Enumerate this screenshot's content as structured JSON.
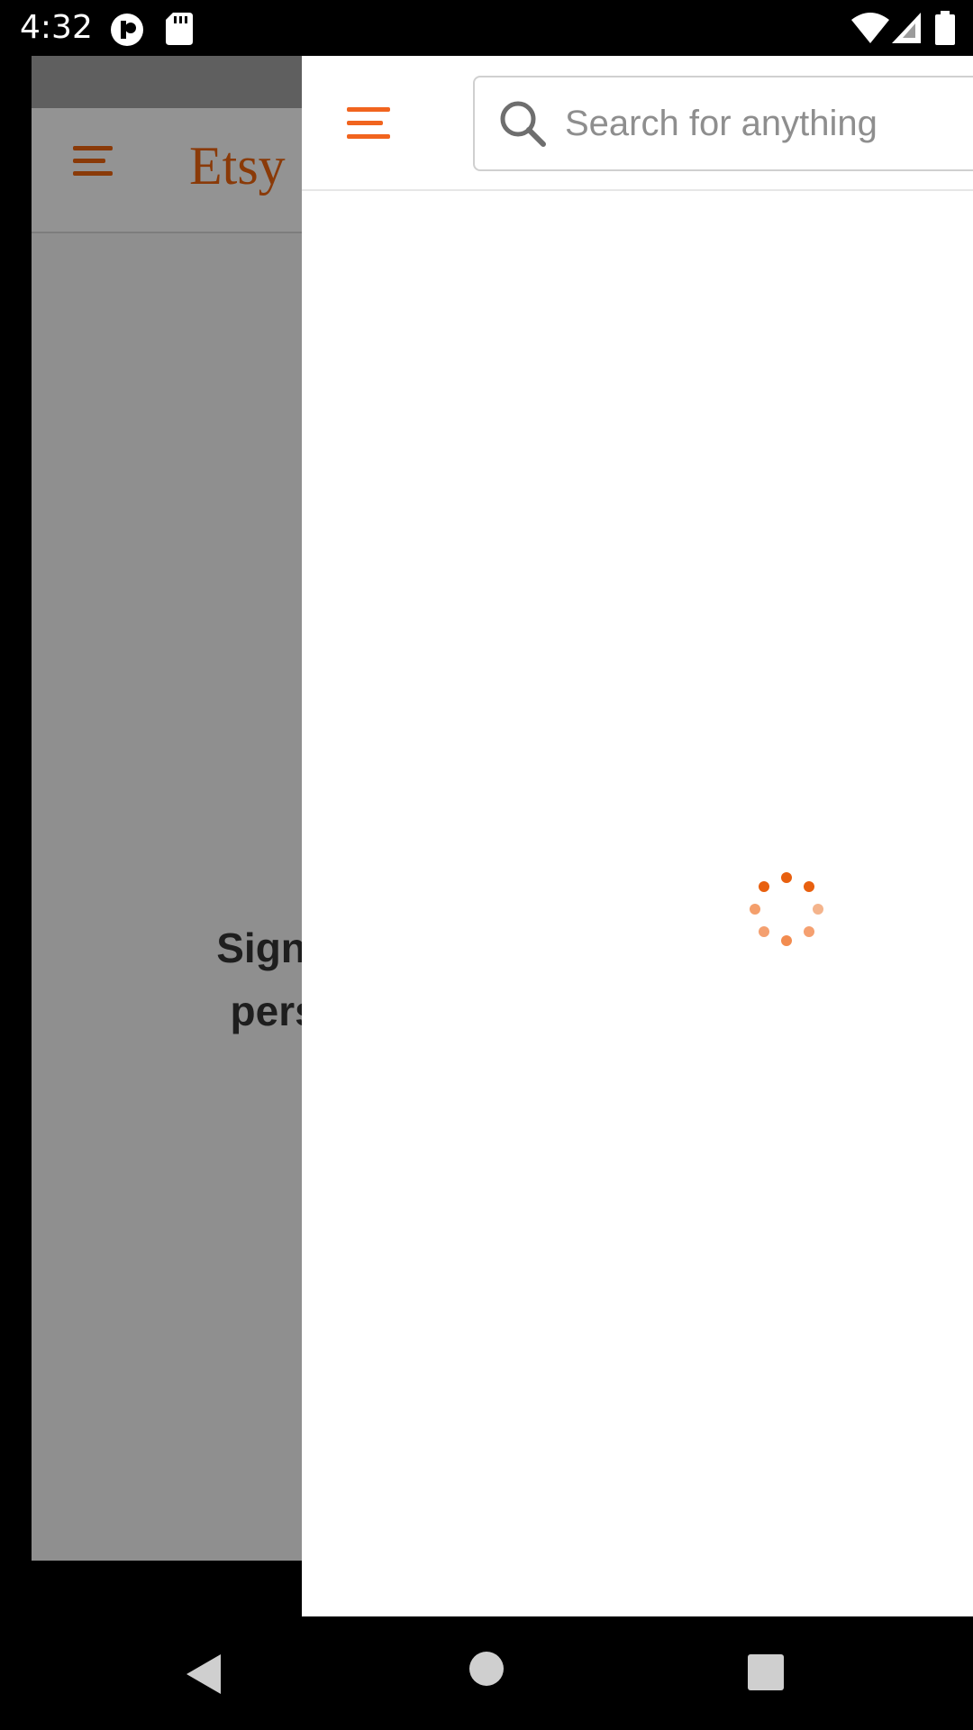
{
  "status_bar": {
    "time": "4:32",
    "icons": [
      "cloud-app-icon",
      "sd-card-icon",
      "wifi-icon",
      "cell-signal-icon",
      "battery-icon"
    ]
  },
  "background_page": {
    "logo": "Etsy",
    "signin_line1": "Sign in to",
    "signin_line2": "persona"
  },
  "header": {
    "search_placeholder": "Search for anything"
  },
  "colors": {
    "accent": "#f1641e",
    "logo_dimmed": "#8a3a08",
    "dim_overlay": "#8f8f8f"
  },
  "navigation": [
    "back-icon",
    "home-icon",
    "recents-icon"
  ]
}
